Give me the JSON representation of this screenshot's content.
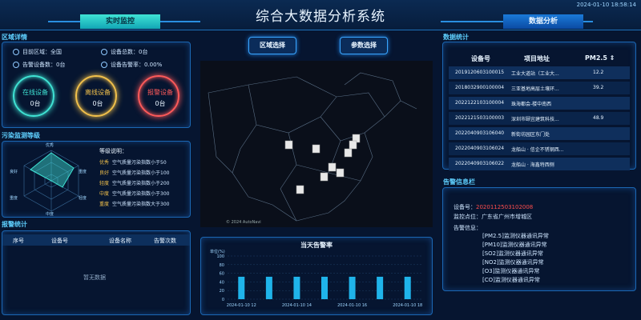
{
  "header": {
    "title": "综合大数据分析系统",
    "datetime": "2024-01-10 18:58:14",
    "tab_left": "实时监控",
    "tab_right": "数据分析"
  },
  "region": {
    "title": "区域详情",
    "target_area": "目前区域：全国",
    "device_total": "设备总数：0台",
    "alarm_count": "告警设备数：0台",
    "alarm_rate": "设备告警率：0.00%",
    "rings": [
      {
        "label": "在线设备",
        "value": "0台",
        "color": "#3fe3d4"
      },
      {
        "label": "离线设备",
        "value": "0台",
        "color": "#f2c14b"
      },
      {
        "label": "报警设备",
        "value": "0台",
        "color": "#ff5a5a"
      }
    ]
  },
  "pollution": {
    "title": "污染监测等级",
    "radar_labels": [
      "优秀",
      "重度",
      "良好",
      "轻度",
      "中度",
      "重度"
    ],
    "legend_title": "等级说明：",
    "levels": [
      {
        "name": "优秀",
        "desc": "空气质量污染指数小于50",
        "color": "#f2c14b"
      },
      {
        "name": "良好",
        "desc": "空气质量污染指数小于100",
        "color": "#f2c14b"
      },
      {
        "name": "轻度",
        "desc": "空气质量污染指数小于200",
        "color": "#f2c14b"
      },
      {
        "name": "中度",
        "desc": "空气质量污染指数小于300",
        "color": "#f2c14b"
      },
      {
        "name": "重度",
        "desc": "空气质量污染指数大于300",
        "color": "#f2c14b"
      }
    ]
  },
  "alarm_stats": {
    "title": "报警统计",
    "columns": [
      "序号",
      "设备号",
      "设备名称",
      "告警次数"
    ],
    "empty": "暂无数据"
  },
  "center": {
    "btn_region": "区域选择",
    "btn_param": "参数选择",
    "map_credit": "© 2024 AutoNavi",
    "chart_title": "当天告警率",
    "y_unit": "单位(%)",
    "y_ticks": [
      "100",
      "80",
      "60",
      "40",
      "20",
      "0"
    ],
    "x_ticks": [
      "2024-01-10 12",
      "2024-01-10 14",
      "2024-01-10 16",
      "2024-01-10 18"
    ]
  },
  "chart_data": {
    "type": "bar",
    "title": "当天告警率",
    "ylabel": "单位(%)",
    "ylim": [
      0,
      100
    ],
    "categories": [
      "12",
      "13",
      "14",
      "15",
      "16",
      "17",
      "18"
    ],
    "values": [
      52,
      52,
      52,
      52,
      52,
      52,
      52
    ]
  },
  "data_stats": {
    "title": "数据统计",
    "columns": [
      "设备号",
      "项目地址",
      "PM2.5"
    ],
    "rows": [
      {
        "id": "2019120603100015",
        "addr": "工业大道站（工业大...",
        "pm": "12.2"
      },
      {
        "id": "2018032900100004",
        "addr": "三亚基地高层土壤环...",
        "pm": "39.2"
      },
      {
        "id": "2022122103100004",
        "addr": "珠海都会-楼中南西",
        "pm": ""
      },
      {
        "id": "2022121503100003",
        "addr": "深圳市颐宜建筑科技...",
        "pm": "48.9"
      },
      {
        "id": "2022040903106040",
        "addr": "新街坊园区东门处",
        "pm": ""
      },
      {
        "id": "2022040903106024",
        "addr": "龙船山 · 信企不锈钢西...",
        "pm": ""
      },
      {
        "id": "2022040903106022",
        "addr": "龙船山 · 海鑫特西侧",
        "pm": ""
      }
    ]
  },
  "alarm_info": {
    "title": "告警信息栏",
    "device_label": "设备号：",
    "device_id": "2020112503102008",
    "location": "监控点位：广东省广州市增城区",
    "info_label": "告警信息：",
    "lines": [
      "[PM2.5]监测仪器通讯异常",
      "[PM10]监测仪器通讯异常",
      "[SO2]监测仪器通讯异常",
      "[NO2]监测仪器通讯异常",
      "[O3]监测仪器通讯异常",
      "[CO]监测仪器通讯异常"
    ]
  }
}
